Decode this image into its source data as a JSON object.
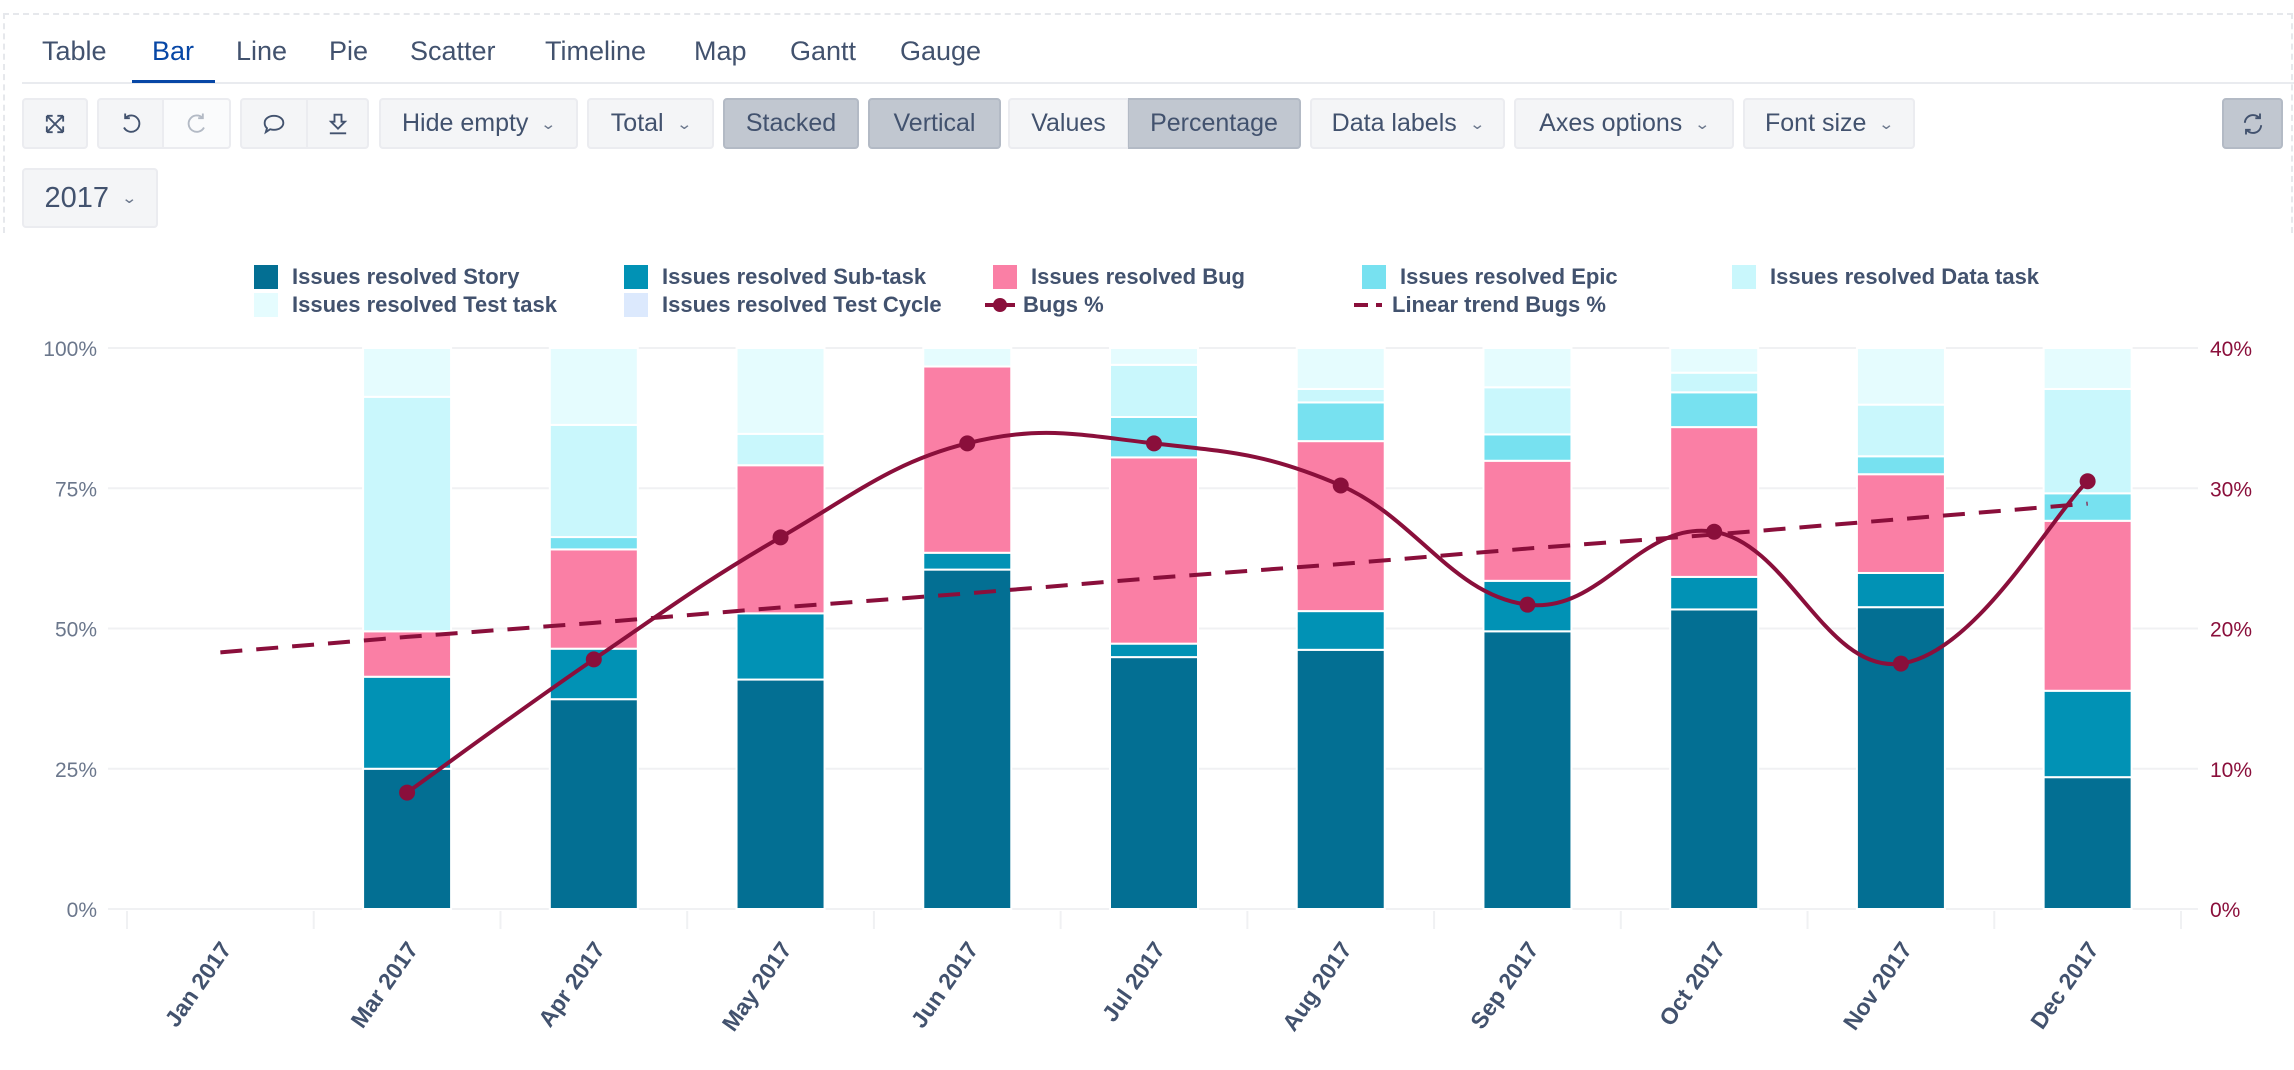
{
  "tabs": [
    {
      "label": "Table",
      "active": false
    },
    {
      "label": "Bar",
      "active": true
    },
    {
      "label": "Line",
      "active": false
    },
    {
      "label": "Pie",
      "active": false
    },
    {
      "label": "Scatter",
      "active": false
    },
    {
      "label": "Timeline",
      "active": false
    },
    {
      "label": "Map",
      "active": false
    },
    {
      "label": "Gantt",
      "active": false
    },
    {
      "label": "Gauge",
      "active": false
    }
  ],
  "toolbar": {
    "fullscreen_icon": "expand-arrows-icon",
    "undo_icon": "undo-icon",
    "redo_icon": "redo-icon",
    "comment_icon": "speech-bubble-icon",
    "download_icon": "download-icon",
    "hide_empty": "Hide empty",
    "total": "Total",
    "stacked": "Stacked",
    "vertical": "Vertical",
    "values": "Values",
    "percentage": "Percentage",
    "data_labels": "Data labels",
    "axes_options": "Axes options",
    "font_size": "Font size",
    "refresh_icon": "refresh-icon",
    "year": "2017"
  },
  "chart_data": {
    "type": "bar",
    "stacked": true,
    "mode": "percentage",
    "title": "",
    "xlabel": "",
    "ylabel": "",
    "ylim": [
      0,
      100
    ],
    "y_ticks": [
      "0%",
      "25%",
      "50%",
      "75%",
      "100%"
    ],
    "y2lim": [
      0,
      40
    ],
    "y2_ticks": [
      "0%",
      "10%",
      "20%",
      "30%",
      "40%"
    ],
    "grid": true,
    "legend_position": "top",
    "categories": [
      "Jan 2017",
      "Mar 2017",
      "Apr 2017",
      "May 2017",
      "Jun 2017",
      "Jul 2017",
      "Aug 2017",
      "Sep 2017",
      "Oct 2017",
      "Nov 2017",
      "Dec 2017"
    ],
    "series": [
      {
        "name": "Issues resolved Story",
        "color": "#036f93",
        "kind": "bar",
        "values": [
          null,
          25.0,
          37.4,
          40.9,
          60.5,
          44.9,
          46.2,
          49.5,
          53.4,
          53.8,
          23.5
        ]
      },
      {
        "name": "Issues resolved Sub-task",
        "color": "#0192b5",
        "kind": "bar",
        "values": [
          null,
          16.4,
          9.0,
          11.8,
          3.0,
          2.4,
          6.9,
          9.0,
          5.8,
          6.1,
          15.4
        ]
      },
      {
        "name": "Issues resolved Bug",
        "color": "#fa7fa5",
        "kind": "bar",
        "values": [
          null,
          8.1,
          17.7,
          26.4,
          33.2,
          33.2,
          30.3,
          21.4,
          26.7,
          17.6,
          30.3
        ]
      },
      {
        "name": "Issues resolved Epic",
        "color": "#77e1f0",
        "kind": "bar",
        "values": [
          null,
          0,
          2.2,
          0,
          0,
          7.2,
          6.9,
          4.7,
          6.2,
          3.2,
          4.9
        ]
      },
      {
        "name": "Issues resolved Data task",
        "color": "#c9f7fc",
        "kind": "bar",
        "values": [
          null,
          41.8,
          20.0,
          5.6,
          0,
          9.3,
          2.4,
          8.4,
          3.5,
          9.2,
          18.6
        ]
      },
      {
        "name": "Issues resolved Test task",
        "color": "#e5fcfe",
        "kind": "bar",
        "values": [
          null,
          8.7,
          13.7,
          15.3,
          3.3,
          3.0,
          7.3,
          7.0,
          4.4,
          10.1,
          7.3
        ]
      },
      {
        "name": "Issues resolved Test Cycle",
        "color": "#dce9fd",
        "kind": "bar",
        "values": [
          null,
          0,
          0,
          0,
          0,
          0,
          0,
          0,
          0,
          0,
          0
        ]
      },
      {
        "name": "Bugs %",
        "color": "#8a0f3b",
        "kind": "line",
        "axis": "right",
        "smooth": true,
        "values": [
          null,
          8.3,
          17.8,
          26.5,
          33.2,
          33.2,
          30.2,
          21.7,
          26.9,
          17.5,
          30.5
        ]
      },
      {
        "name": "Linear trend Bugs %",
        "color": "#8a0f3b",
        "kind": "dashed-line",
        "axis": "right",
        "values": [
          18.3,
          19.4,
          20.4,
          21.5,
          22.5,
          23.6,
          24.6,
          25.7,
          26.7,
          27.8,
          28.9
        ]
      }
    ]
  }
}
